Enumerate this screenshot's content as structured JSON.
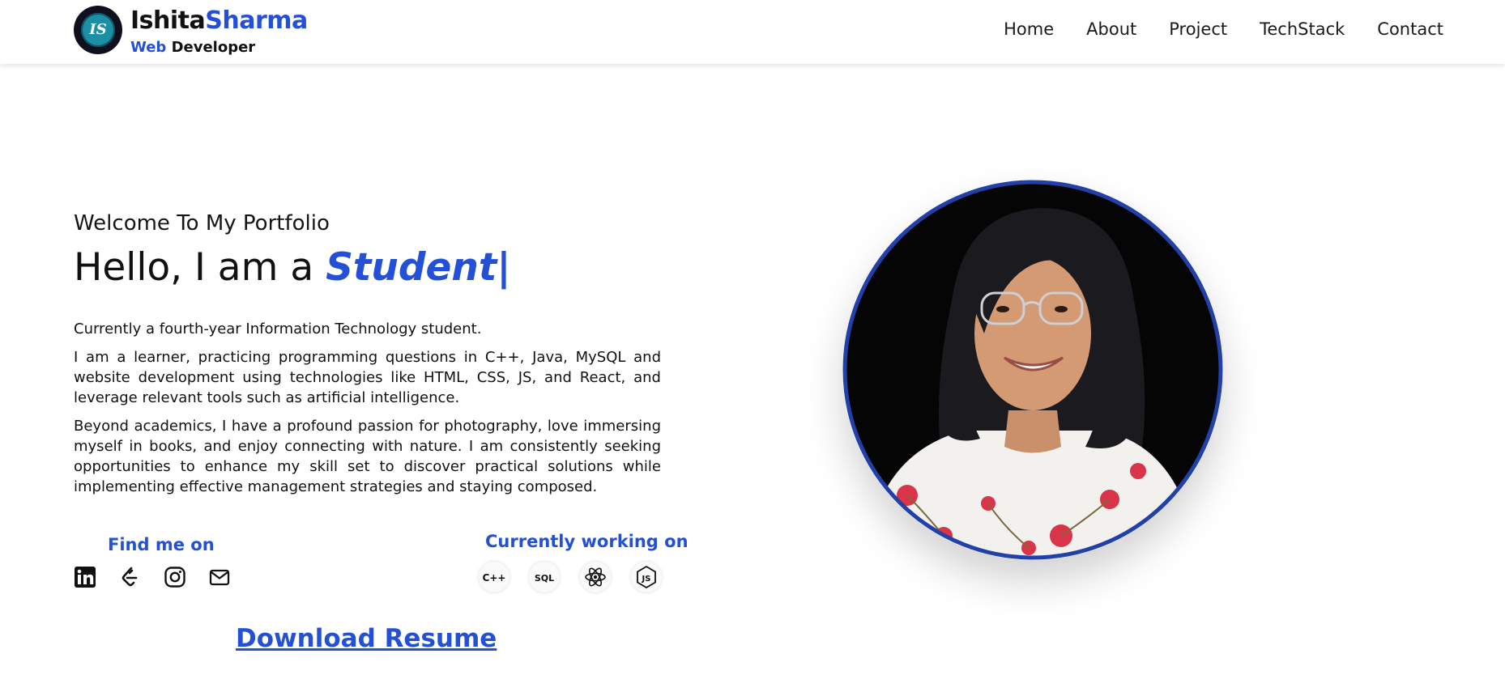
{
  "header": {
    "logo_initials": "IS",
    "brand_first": "Ishita",
    "brand_last": "Sharma",
    "subtitle_highlight": "Web",
    "subtitle_rest": " Developer",
    "nav": [
      "Home",
      "About",
      "Project",
      "TechStack",
      "Contact"
    ]
  },
  "hero": {
    "welcome": "Welcome To My Portfolio",
    "hello_prefix": "Hello, I am a ",
    "role": "Student",
    "cursor": "|",
    "paragraphs": [
      "Currently a fourth-year Information Technology student.",
      "I am a learner, practicing programming questions in C++, Java, MySQL and website development using technologies like HTML, CSS, JS, and React, and leverage relevant tools such as artificial intelligence.",
      "Beyond academics, I have a profound passion for photography, love immersing myself in books, and enjoy connecting with nature. I am consistently seeking opportunities to enhance my skill set to discover practical solutions while implementing effective management strategies and staying composed."
    ],
    "find_me_on": "Find me on",
    "social_icons": [
      "linkedin-icon",
      "leetcode-icon",
      "instagram-icon",
      "mail-icon"
    ],
    "currently_working_on": "Currently working on",
    "tech_icons": [
      {
        "name": "cpp-icon",
        "label": "C++"
      },
      {
        "name": "sql-icon",
        "label": "SQL"
      },
      {
        "name": "react-icon",
        "label": ""
      },
      {
        "name": "nodejs-icon",
        "label": "JS"
      }
    ],
    "download_resume": "Download Resume"
  },
  "colors": {
    "accent": "#2450d6",
    "portrait_ring": "#2140a8",
    "text": "#111111"
  }
}
